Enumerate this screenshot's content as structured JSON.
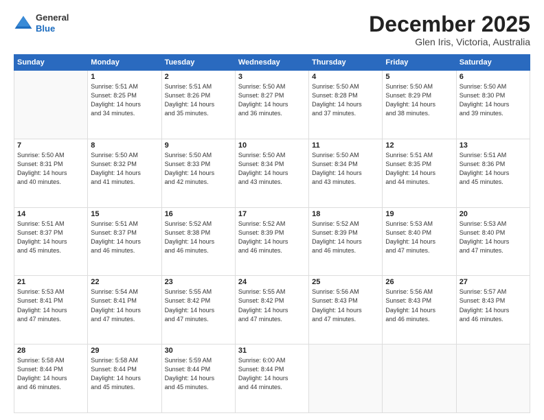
{
  "header": {
    "logo_general": "General",
    "logo_blue": "Blue",
    "title": "December 2025",
    "subtitle": "Glen Iris, Victoria, Australia"
  },
  "calendar": {
    "days_of_week": [
      "Sunday",
      "Monday",
      "Tuesday",
      "Wednesday",
      "Thursday",
      "Friday",
      "Saturday"
    ],
    "weeks": [
      [
        {
          "day": "",
          "detail": ""
        },
        {
          "day": "1",
          "detail": "Sunrise: 5:51 AM\nSunset: 8:25 PM\nDaylight: 14 hours\nand 34 minutes."
        },
        {
          "day": "2",
          "detail": "Sunrise: 5:51 AM\nSunset: 8:26 PM\nDaylight: 14 hours\nand 35 minutes."
        },
        {
          "day": "3",
          "detail": "Sunrise: 5:50 AM\nSunset: 8:27 PM\nDaylight: 14 hours\nand 36 minutes."
        },
        {
          "day": "4",
          "detail": "Sunrise: 5:50 AM\nSunset: 8:28 PM\nDaylight: 14 hours\nand 37 minutes."
        },
        {
          "day": "5",
          "detail": "Sunrise: 5:50 AM\nSunset: 8:29 PM\nDaylight: 14 hours\nand 38 minutes."
        },
        {
          "day": "6",
          "detail": "Sunrise: 5:50 AM\nSunset: 8:30 PM\nDaylight: 14 hours\nand 39 minutes."
        }
      ],
      [
        {
          "day": "7",
          "detail": "Sunrise: 5:50 AM\nSunset: 8:31 PM\nDaylight: 14 hours\nand 40 minutes."
        },
        {
          "day": "8",
          "detail": "Sunrise: 5:50 AM\nSunset: 8:32 PM\nDaylight: 14 hours\nand 41 minutes."
        },
        {
          "day": "9",
          "detail": "Sunrise: 5:50 AM\nSunset: 8:33 PM\nDaylight: 14 hours\nand 42 minutes."
        },
        {
          "day": "10",
          "detail": "Sunrise: 5:50 AM\nSunset: 8:34 PM\nDaylight: 14 hours\nand 43 minutes."
        },
        {
          "day": "11",
          "detail": "Sunrise: 5:50 AM\nSunset: 8:34 PM\nDaylight: 14 hours\nand 43 minutes."
        },
        {
          "day": "12",
          "detail": "Sunrise: 5:51 AM\nSunset: 8:35 PM\nDaylight: 14 hours\nand 44 minutes."
        },
        {
          "day": "13",
          "detail": "Sunrise: 5:51 AM\nSunset: 8:36 PM\nDaylight: 14 hours\nand 45 minutes."
        }
      ],
      [
        {
          "day": "14",
          "detail": "Sunrise: 5:51 AM\nSunset: 8:37 PM\nDaylight: 14 hours\nand 45 minutes."
        },
        {
          "day": "15",
          "detail": "Sunrise: 5:51 AM\nSunset: 8:37 PM\nDaylight: 14 hours\nand 46 minutes."
        },
        {
          "day": "16",
          "detail": "Sunrise: 5:52 AM\nSunset: 8:38 PM\nDaylight: 14 hours\nand 46 minutes."
        },
        {
          "day": "17",
          "detail": "Sunrise: 5:52 AM\nSunset: 8:39 PM\nDaylight: 14 hours\nand 46 minutes."
        },
        {
          "day": "18",
          "detail": "Sunrise: 5:52 AM\nSunset: 8:39 PM\nDaylight: 14 hours\nand 46 minutes."
        },
        {
          "day": "19",
          "detail": "Sunrise: 5:53 AM\nSunset: 8:40 PM\nDaylight: 14 hours\nand 47 minutes."
        },
        {
          "day": "20",
          "detail": "Sunrise: 5:53 AM\nSunset: 8:40 PM\nDaylight: 14 hours\nand 47 minutes."
        }
      ],
      [
        {
          "day": "21",
          "detail": "Sunrise: 5:53 AM\nSunset: 8:41 PM\nDaylight: 14 hours\nand 47 minutes."
        },
        {
          "day": "22",
          "detail": "Sunrise: 5:54 AM\nSunset: 8:41 PM\nDaylight: 14 hours\nand 47 minutes."
        },
        {
          "day": "23",
          "detail": "Sunrise: 5:55 AM\nSunset: 8:42 PM\nDaylight: 14 hours\nand 47 minutes."
        },
        {
          "day": "24",
          "detail": "Sunrise: 5:55 AM\nSunset: 8:42 PM\nDaylight: 14 hours\nand 47 minutes."
        },
        {
          "day": "25",
          "detail": "Sunrise: 5:56 AM\nSunset: 8:43 PM\nDaylight: 14 hours\nand 47 minutes."
        },
        {
          "day": "26",
          "detail": "Sunrise: 5:56 AM\nSunset: 8:43 PM\nDaylight: 14 hours\nand 46 minutes."
        },
        {
          "day": "27",
          "detail": "Sunrise: 5:57 AM\nSunset: 8:43 PM\nDaylight: 14 hours\nand 46 minutes."
        }
      ],
      [
        {
          "day": "28",
          "detail": "Sunrise: 5:58 AM\nSunset: 8:44 PM\nDaylight: 14 hours\nand 46 minutes."
        },
        {
          "day": "29",
          "detail": "Sunrise: 5:58 AM\nSunset: 8:44 PM\nDaylight: 14 hours\nand 45 minutes."
        },
        {
          "day": "30",
          "detail": "Sunrise: 5:59 AM\nSunset: 8:44 PM\nDaylight: 14 hours\nand 45 minutes."
        },
        {
          "day": "31",
          "detail": "Sunrise: 6:00 AM\nSunset: 8:44 PM\nDaylight: 14 hours\nand 44 minutes."
        },
        {
          "day": "",
          "detail": ""
        },
        {
          "day": "",
          "detail": ""
        },
        {
          "day": "",
          "detail": ""
        }
      ]
    ]
  }
}
